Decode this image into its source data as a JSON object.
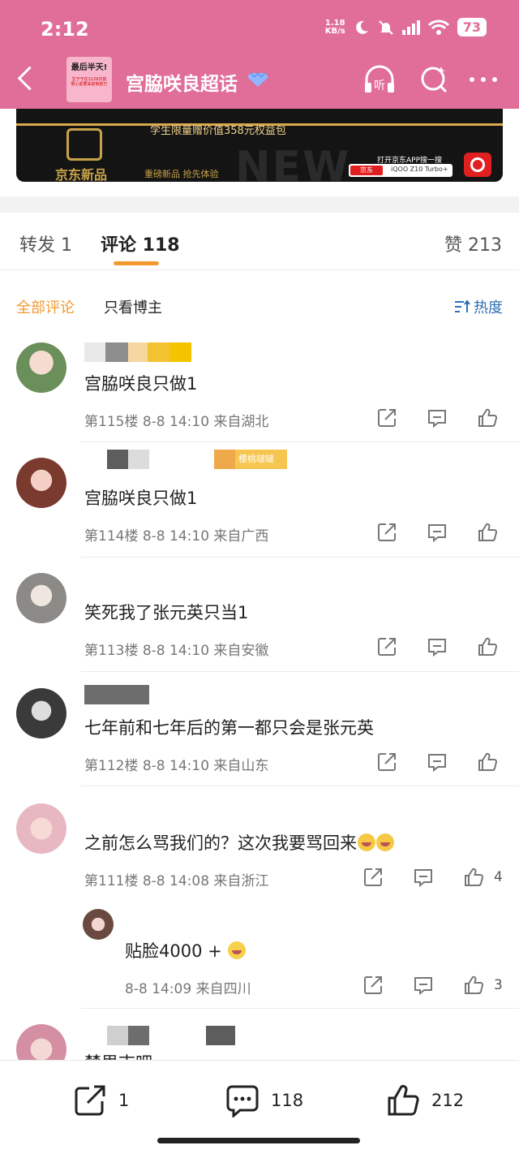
{
  "status_bar": {
    "time": "2:12",
    "net_speed_value": "1.18",
    "net_speed_unit": "KB/s",
    "battery": "73"
  },
  "header": {
    "topic_title": "宫脇咲良超话",
    "thumb_line1": "最后半天!",
    "thumb_line2": "生于于在1129日前 努心前要采前制前已"
  },
  "ad": {
    "subtitle": "学生限量赠价值358元权益包",
    "brand": "京东新品",
    "slogan": "重磅新品 抢先体验",
    "watermark": "NEW",
    "cta": "打开京东APP搜一搜",
    "search_brand": "京东",
    "search_text": "iQOO Z10 Turbo+"
  },
  "tabs": [
    {
      "label": "转发 1"
    },
    {
      "label": "评论 118"
    },
    {
      "label": "赞 213"
    }
  ],
  "filters": {
    "all": "全部评论",
    "author_only": "只看博主",
    "sort": "热度"
  },
  "comments": [
    {
      "text": "宫脇咲良只做1",
      "meta": "第115楼 8-8 14:10 来自湖北",
      "likes": ""
    },
    {
      "text": "宫脇咲良只做1",
      "meta": "第114楼 8-8 14:10 来自广西",
      "likes": "",
      "badge": "樱桃啵啵"
    },
    {
      "text": "笑死我了张元英只当1",
      "meta": "第113楼 8-8 14:10 来自安徽",
      "likes": ""
    },
    {
      "text": "七年前和七年后的第一都只会是张元英",
      "meta": "第112楼 8-8 14:10 来自山东",
      "likes": ""
    },
    {
      "text": "之前怎么骂我们的？这次我要骂回来",
      "meta": "第111楼 8-8 14:08 来自浙江",
      "likes": "4"
    },
    {
      "text": "楚思志吧",
      "meta": "",
      "likes": ""
    }
  ],
  "reply": {
    "text": "贴脸4000 +",
    "meta": "8-8 14:09 来自四川",
    "likes": "3"
  },
  "bottom_bar": {
    "repost_count": "1",
    "comment_count": "118",
    "like_count": "212"
  }
}
